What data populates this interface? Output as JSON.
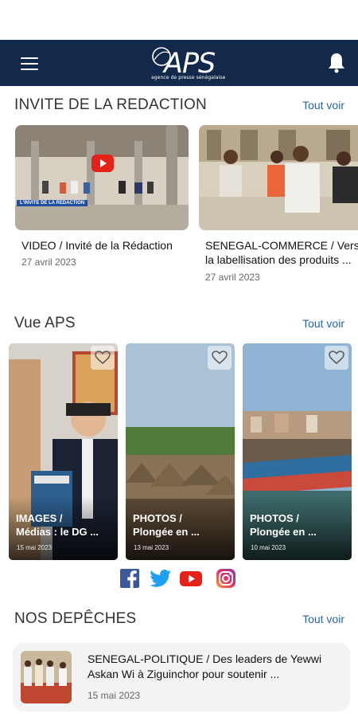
{
  "header": {
    "logo_text": "APS",
    "logo_tagline": "agence de presse sénégalaise"
  },
  "sections": {
    "invite": {
      "title": "INVITE DE LA REDACTION",
      "see_all": "Tout voir"
    },
    "vue": {
      "title": "Vue APS",
      "see_all": "Tout voir"
    },
    "depeches": {
      "title": "NOS DEPÊCHES",
      "see_all": "Tout voir"
    }
  },
  "videos": [
    {
      "badge": "L'INVITE DE LA REDACTION",
      "title": "VIDEO / Invité de la Rédaction",
      "date": "27 avril 2023"
    },
    {
      "title_line1": "SENEGAL-COMMERCE / Vers",
      "title_line2": "la labellisation des produits ...",
      "date": "27 avril 2023"
    }
  ],
  "photos": [
    {
      "line1": "IMAGES /",
      "line2": "Médias : le DG ...",
      "date": "15 mai 2023"
    },
    {
      "line1": "PHOTOS /",
      "line2": "Plongée en ...",
      "date": "13 mai 2023"
    },
    {
      "line1": "PHOTOS /",
      "line2": "Plongée en ...",
      "date": "10 mai 2023"
    }
  ],
  "news": [
    {
      "title": "SENEGAL-POLITIQUE / Des leaders de Yewwi Askan Wi à Ziguinchor pour soutenir ...",
      "date": "15 mai 2023"
    }
  ],
  "colors": {
    "header_bg": "#13294b",
    "link": "#2c63a6",
    "facebook": "#3b5998",
    "twitter": "#1da1f2",
    "youtube": "#e62117",
    "instagram": "#c13584"
  }
}
